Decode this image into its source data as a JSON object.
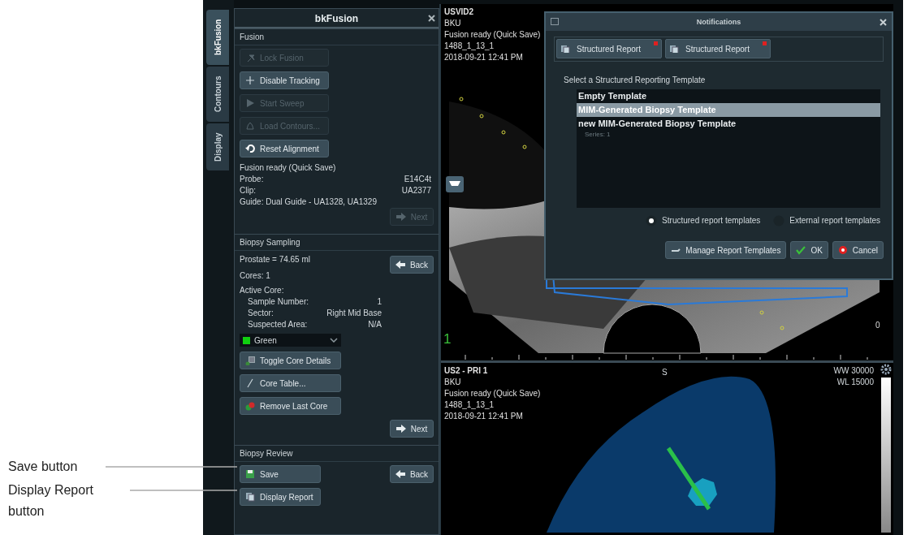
{
  "callouts": [
    {
      "text": "Save button"
    },
    {
      "text": "Display Report button"
    }
  ],
  "side_tabs": [
    {
      "label": "bkFusion",
      "selected": true
    },
    {
      "label": "Contours",
      "selected": false
    },
    {
      "label": "Display",
      "selected": false
    }
  ],
  "panel": {
    "title": "bkFusion",
    "fusion": {
      "title": "Fusion",
      "buttons": [
        {
          "label": "Lock Fusion",
          "kind": "pin",
          "disabled": true
        },
        {
          "label": "Disable Tracking",
          "kind": "plus",
          "disabled": false
        },
        {
          "label": "Start Sweep",
          "kind": "play",
          "disabled": true
        },
        {
          "label": "Load Contours...",
          "kind": "bell",
          "disabled": true
        },
        {
          "label": "Reset Alignment",
          "kind": "undo",
          "disabled": false
        }
      ],
      "status": "Fusion ready (Quick Save)",
      "info": [
        {
          "label": "Probe:",
          "value": "E14C4t"
        },
        {
          "label": "Clip:",
          "value": "UA2377"
        }
      ],
      "guide": "Guide: Dual Guide - UA1328, UA1329",
      "next": {
        "label": "Next",
        "disabled": true
      }
    },
    "sampling": {
      "title": "Biopsy Sampling",
      "prostate": "Prostate = 74.65 ml",
      "cores": "Cores: 1",
      "active_core": "Active Core:",
      "details": [
        {
          "label": "Sample Number:",
          "value": "1"
        },
        {
          "label": "Sector:",
          "value": "Right Mid Base"
        },
        {
          "label": "Suspected Area:",
          "value": "N/A"
        }
      ],
      "color_select": {
        "value": "Green",
        "color": "#10d010"
      },
      "back": {
        "label": "Back",
        "disabled": false
      },
      "buttons": [
        {
          "label": "Toggle Core Details",
          "kind": "toggle",
          "disabled": false
        },
        {
          "label": "Core Table...",
          "kind": "line",
          "disabled": false
        },
        {
          "label": "Remove Last Core",
          "kind": "remove",
          "disabled": false
        }
      ],
      "next": {
        "label": "Next",
        "disabled": false
      }
    },
    "review": {
      "title": "Biopsy Review",
      "buttons": [
        {
          "label": "Save",
          "kind": "save",
          "disabled": false
        },
        {
          "label": "Display Report",
          "kind": "report",
          "disabled": false
        }
      ],
      "back": {
        "label": "Back",
        "disabled": false
      }
    }
  },
  "viewer_top": {
    "lines": [
      "USVID2",
      "BKU",
      "Fusion ready (Quick Save)",
      "1488_1_13_1",
      "2018-09-21 12:41 PM"
    ],
    "marker": "1",
    "depth": "0"
  },
  "viewer_bottom": {
    "lines": [
      "US2 - PRI 1",
      "BKU",
      "Fusion ready (Quick Save)",
      "1488_1_13_1",
      "2018-09-21 12:41 PM"
    ],
    "orientation": "S",
    "window": [
      "WW 30000",
      "WL 15000"
    ]
  },
  "dialog": {
    "title": "Notifications",
    "tabs": [
      {
        "label": "Structured Report"
      },
      {
        "label": "Structured Report"
      }
    ],
    "prompt": "Select a Structured Reporting Template",
    "templates": [
      {
        "name": "Empty Template",
        "selected": false
      },
      {
        "name": "MIM-Generated Biopsy Template",
        "selected": true
      },
      {
        "name": "new MIM-Generated Biopsy Template",
        "subtitle": "Series: 1",
        "selected": false
      }
    ],
    "radios": [
      {
        "label": "Structured report templates",
        "selected": true
      },
      {
        "label": "External report templates",
        "selected": false
      }
    ],
    "buttons": [
      {
        "label": "Manage Report Templates",
        "kind": "manage"
      },
      {
        "label": "OK",
        "kind": "ok"
      },
      {
        "label": "Cancel",
        "kind": "cancel"
      }
    ]
  }
}
